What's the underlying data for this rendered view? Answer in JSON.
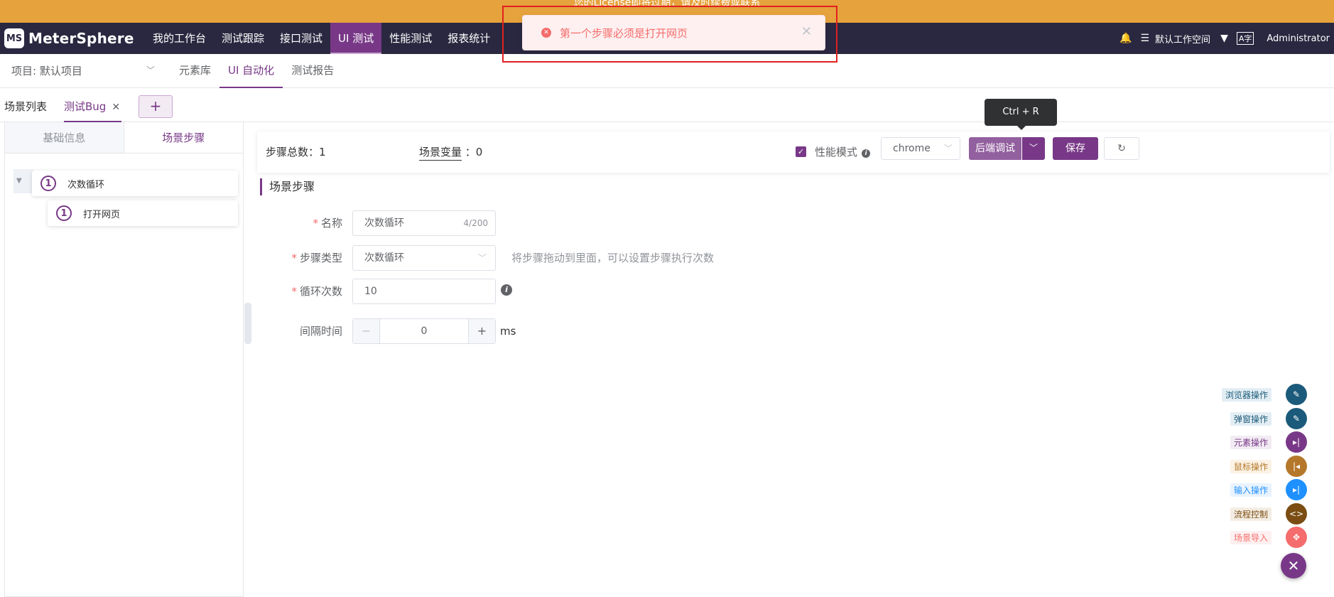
{
  "banner": {
    "text": "您的License即将过期，请及时续费或联系"
  },
  "app": {
    "logo_text": "MS",
    "name": "MeterSphere"
  },
  "topnav": {
    "items": [
      {
        "label": "我的工作台"
      },
      {
        "label": "测试跟踪"
      },
      {
        "label": "接口测试"
      },
      {
        "label": "UI 测试",
        "active": true
      },
      {
        "label": "性能测试"
      },
      {
        "label": "报表统计"
      }
    ],
    "workspace": "默认工作空间",
    "user": "Administrator"
  },
  "toast": {
    "message": "第一个步骤必须是打开网页"
  },
  "subnav": {
    "project": "项目: 默认项目",
    "tabs": [
      {
        "label": "元素库"
      },
      {
        "label": "UI 自动化",
        "active": true
      },
      {
        "label": "测试报告"
      }
    ]
  },
  "tabs": {
    "list_label": "场景列表",
    "current_label": "测试Bug",
    "add_label": "+"
  },
  "tooltip": {
    "text": "Ctrl + R"
  },
  "left_panel": {
    "tab_basic": "基础信息",
    "tab_steps": "场景步骤",
    "nodes": [
      {
        "num": "1",
        "label": "次数循环"
      },
      {
        "num": "1",
        "label": "打开网页"
      }
    ]
  },
  "infobar": {
    "steps_total_label": "步骤总数：1",
    "scene_var_label": "场景变量",
    "scene_var_value": "：0",
    "perf_mode_label": "性能模式",
    "perf_mode_checked": true,
    "browser": "chrome",
    "debug_label": "后端调试",
    "save_label": "保存"
  },
  "form": {
    "section_title": "场景步骤",
    "name_label": "名称",
    "name_value": "次数循环",
    "name_count": "4/200",
    "type_label": "步骤类型",
    "type_value": "次数循环",
    "type_hint": "将步骤拖动到里面，可以设置步骤执行次数",
    "loop_label": "循环次数",
    "loop_value": "10",
    "interval_label": "间隔时间",
    "interval_value": "0",
    "interval_unit": "ms"
  },
  "fab_menu": [
    {
      "label": "浏览器操作",
      "color": "#1b5a7a",
      "bg": "#e3eef4",
      "icon": "pencil-icon"
    },
    {
      "label": "弹窗操作",
      "color": "#1b5a7a",
      "bg": "#e3eef4",
      "icon": "pencil-icon"
    },
    {
      "label": "元素操作",
      "color": "#783887",
      "bg": "#f2ebf3",
      "icon": "skip-forward-icon"
    },
    {
      "label": "鼠标操作",
      "color": "#b5782a",
      "bg": "#fbf2e4",
      "icon": "skip-back-icon"
    },
    {
      "label": "输入操作",
      "color": "#1e90ff",
      "bg": "#e8f3ff",
      "icon": "skip-forward-icon"
    },
    {
      "label": "流程控制",
      "color": "#7b4d12",
      "bg": "#f4ede3",
      "icon": "code-icon"
    },
    {
      "label": "场景导入",
      "color": "#f56c6c",
      "bg": "#fef0f0",
      "icon": "import-icon"
    }
  ]
}
